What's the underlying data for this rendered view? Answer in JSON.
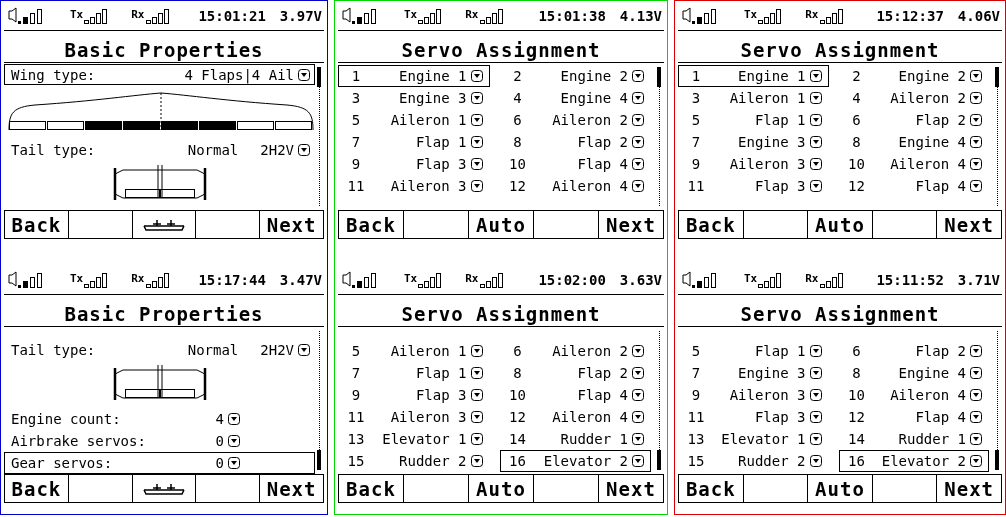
{
  "columns": [
    {
      "color": "#0000c8",
      "screens": [
        {
          "kind": "basic",
          "status": {
            "tx_label": "Tx",
            "rx_label": "Rx",
            "time": "15:01:21",
            "voltage": "3.97V"
          },
          "title": "Basic Properties",
          "rows": [
            {
              "kind": "option",
              "label": "Wing type:",
              "value": "4 Flaps|4 Ail",
              "selected": true
            },
            {
              "kind": "wing"
            },
            {
              "kind": "tail",
              "label": "Tail type:",
              "value": "Normal",
              "option": "2H2V",
              "selected": false
            },
            {
              "kind": "tail-drawing"
            }
          ],
          "buttons": [
            {
              "kind": "text",
              "label": "Back"
            },
            {
              "kind": "empty"
            },
            {
              "kind": "icon"
            },
            {
              "kind": "empty"
            },
            {
              "kind": "text",
              "label": "Next"
            }
          ]
        },
        {
          "kind": "basic",
          "status": {
            "tx_label": "Tx",
            "rx_label": "Rx",
            "time": "15:17:44",
            "voltage": "3.47V"
          },
          "title": "Basic Properties",
          "rows": [
            {
              "kind": "tail",
              "label": "Tail type:",
              "value": "Normal",
              "option": "2H2V",
              "selected": false
            },
            {
              "kind": "tail-drawing"
            },
            {
              "kind": "count",
              "label": "Engine count:",
              "value": "4",
              "selected": false
            },
            {
              "kind": "count",
              "label": "Airbrake servos:",
              "value": "0",
              "selected": false
            },
            {
              "kind": "count",
              "label": "Gear servos:",
              "value": "0",
              "selected": true
            }
          ],
          "buttons": [
            {
              "kind": "text",
              "label": "Back"
            },
            {
              "kind": "empty"
            },
            {
              "kind": "icon"
            },
            {
              "kind": "empty"
            },
            {
              "kind": "text",
              "label": "Next"
            }
          ]
        }
      ]
    },
    {
      "color": "#00d800",
      "screens": [
        {
          "kind": "servos",
          "status": {
            "tx_label": "Tx",
            "rx_label": "Rx",
            "time": "15:01:38",
            "voltage": "4.13V"
          },
          "title": "Servo Assignment",
          "servos": [
            {
              "number": "1",
              "function": "Engine 1",
              "selected": true
            },
            {
              "number": "2",
              "function": "Engine 2",
              "selected": false
            },
            {
              "number": "3",
              "function": "Engine 3",
              "selected": false
            },
            {
              "number": "4",
              "function": "Engine 4",
              "selected": false
            },
            {
              "number": "5",
              "function": "Aileron 1",
              "selected": false
            },
            {
              "number": "6",
              "function": "Aileron 2",
              "selected": false
            },
            {
              "number": "7",
              "function": "Flap 1",
              "selected": false
            },
            {
              "number": "8",
              "function": "Flap 2",
              "selected": false
            },
            {
              "number": "9",
              "function": "Flap 3",
              "selected": false
            },
            {
              "number": "10",
              "function": "Flap 4",
              "selected": false
            },
            {
              "number": "11",
              "function": "Aileron 3",
              "selected": false
            },
            {
              "number": "12",
              "function": "Aileron 4",
              "selected": false
            }
          ],
          "buttons": [
            {
              "kind": "text",
              "label": "Back"
            },
            {
              "kind": "empty"
            },
            {
              "kind": "text",
              "label": "Auto"
            },
            {
              "kind": "empty"
            },
            {
              "kind": "text",
              "label": "Next"
            }
          ]
        },
        {
          "kind": "servos",
          "status": {
            "tx_label": "Tx",
            "rx_label": "Rx",
            "time": "15:02:00",
            "voltage": "3.63V"
          },
          "title": "Servo Assignment",
          "servos": [
            {
              "number": "5",
              "function": "Aileron 1",
              "selected": false
            },
            {
              "number": "6",
              "function": "Aileron 2",
              "selected": false
            },
            {
              "number": "7",
              "function": "Flap 1",
              "selected": false
            },
            {
              "number": "8",
              "function": "Flap 2",
              "selected": false
            },
            {
              "number": "9",
              "function": "Flap 3",
              "selected": false
            },
            {
              "number": "10",
              "function": "Flap 4",
              "selected": false
            },
            {
              "number": "11",
              "function": "Aileron 3",
              "selected": false
            },
            {
              "number": "12",
              "function": "Aileron 4",
              "selected": false
            },
            {
              "number": "13",
              "function": "Elevator 1",
              "selected": false
            },
            {
              "number": "14",
              "function": "Rudder 1",
              "selected": false
            },
            {
              "number": "15",
              "function": "Rudder 2",
              "selected": false
            },
            {
              "number": "16",
              "function": "Elevator 2",
              "selected": true
            }
          ],
          "buttons": [
            {
              "kind": "text",
              "label": "Back"
            },
            {
              "kind": "empty"
            },
            {
              "kind": "text",
              "label": "Auto"
            },
            {
              "kind": "empty"
            },
            {
              "kind": "text",
              "label": "Next"
            }
          ]
        }
      ]
    },
    {
      "color": "#d80000",
      "screens": [
        {
          "kind": "servos",
          "status": {
            "tx_label": "Tx",
            "rx_label": "Rx",
            "time": "15:12:37",
            "voltage": "4.06V"
          },
          "title": "Servo Assignment",
          "servos": [
            {
              "number": "1",
              "function": "Engine 1",
              "selected": true
            },
            {
              "number": "2",
              "function": "Engine 2",
              "selected": false
            },
            {
              "number": "3",
              "function": "Aileron 1",
              "selected": false
            },
            {
              "number": "4",
              "function": "Aileron 2",
              "selected": false
            },
            {
              "number": "5",
              "function": "Flap 1",
              "selected": false
            },
            {
              "number": "6",
              "function": "Flap 2",
              "selected": false
            },
            {
              "number": "7",
              "function": "Engine 3",
              "selected": false
            },
            {
              "number": "8",
              "function": "Engine 4",
              "selected": false
            },
            {
              "number": "9",
              "function": "Aileron 3",
              "selected": false
            },
            {
              "number": "10",
              "function": "Aileron 4",
              "selected": false
            },
            {
              "number": "11",
              "function": "Flap 3",
              "selected": false
            },
            {
              "number": "12",
              "function": "Flap 4",
              "selected": false
            }
          ],
          "buttons": [
            {
              "kind": "text",
              "label": "Back"
            },
            {
              "kind": "empty"
            },
            {
              "kind": "text",
              "label": "Auto"
            },
            {
              "kind": "empty"
            },
            {
              "kind": "text",
              "label": "Next"
            }
          ]
        },
        {
          "kind": "servos",
          "status": {
            "tx_label": "Tx",
            "rx_label": "Rx",
            "time": "15:11:52",
            "voltage": "3.71V"
          },
          "title": "Servo Assignment",
          "servos": [
            {
              "number": "5",
              "function": "Flap 1",
              "selected": false
            },
            {
              "number": "6",
              "function": "Flap 2",
              "selected": false
            },
            {
              "number": "7",
              "function": "Engine 3",
              "selected": false
            },
            {
              "number": "8",
              "function": "Engine 4",
              "selected": false
            },
            {
              "number": "9",
              "function": "Aileron 3",
              "selected": false
            },
            {
              "number": "10",
              "function": "Aileron 4",
              "selected": false
            },
            {
              "number": "11",
              "function": "Flap 3",
              "selected": false
            },
            {
              "number": "12",
              "function": "Flap 4",
              "selected": false
            },
            {
              "number": "13",
              "function": "Elevator 1",
              "selected": false
            },
            {
              "number": "14",
              "function": "Rudder 1",
              "selected": false
            },
            {
              "number": "15",
              "function": "Rudder 2",
              "selected": false
            },
            {
              "number": "16",
              "function": "Elevator 2",
              "selected": true
            }
          ],
          "buttons": [
            {
              "kind": "text",
              "label": "Back"
            },
            {
              "kind": "empty"
            },
            {
              "kind": "text",
              "label": "Auto"
            },
            {
              "kind": "empty"
            },
            {
              "kind": "text",
              "label": "Next"
            }
          ]
        }
      ]
    }
  ]
}
